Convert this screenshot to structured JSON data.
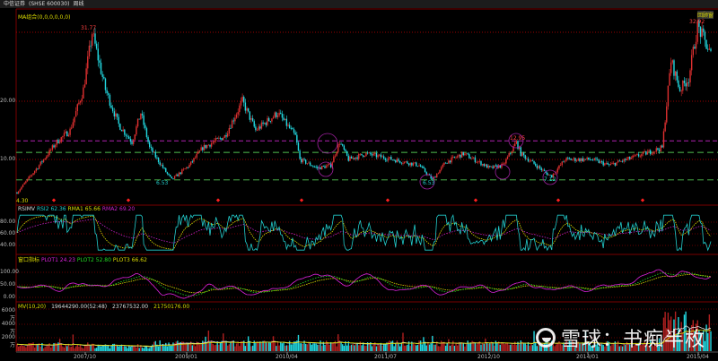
{
  "header": {
    "stock_name": "中信证券",
    "stock_code": "(SHSE 600030)",
    "period": "周线"
  },
  "chart_data": [
    {
      "type": "candlestick",
      "title": "MA组合(0,0,0,0,0,0)",
      "price_labels": {
        "high": "31.77",
        "high2": "32.92",
        "lows": [
          "6.53",
          "6.53",
          "7.12"
        ],
        "circle_label": "12.95",
        "start": "4.30"
      },
      "right_label": "回顾窗",
      "yticks": [
        "20.00",
        "10.00"
      ],
      "ylim": [
        4,
        34
      ],
      "reference_lines": {
        "magenta": 13.2,
        "green": [
          11.2,
          6.5
        ]
      },
      "xticks": [
        "2007/10",
        "2009/01",
        "2010/04",
        "2011/07",
        "2012/10",
        "2014/01",
        "2015/04"
      ],
      "path": [
        [
          0,
          4.3
        ],
        [
          5,
          9
        ],
        [
          9,
          13
        ],
        [
          12,
          15
        ],
        [
          15,
          22
        ],
        [
          17,
          31.77
        ],
        [
          20,
          22
        ],
        [
          23,
          16
        ],
        [
          26,
          13
        ],
        [
          28,
          18
        ],
        [
          30,
          12
        ],
        [
          34,
          7.5
        ],
        [
          35,
          6.53
        ],
        [
          39,
          9
        ],
        [
          42,
          12
        ],
        [
          47,
          14
        ],
        [
          51,
          20
        ],
        [
          54,
          15
        ],
        [
          59,
          18
        ],
        [
          63,
          14
        ],
        [
          64,
          10
        ],
        [
          68,
          8.5
        ],
        [
          71,
          9
        ],
        [
          73,
          13
        ],
        [
          75,
          10
        ],
        [
          79,
          11
        ],
        [
          85,
          10
        ],
        [
          91,
          9
        ],
        [
          94,
          6.53
        ],
        [
          97,
          9.5
        ],
        [
          101,
          11
        ],
        [
          107,
          8.5
        ],
        [
          110,
          9
        ],
        [
          113,
          12.95
        ],
        [
          114,
          11
        ],
        [
          120,
          7.5
        ],
        [
          121,
          7.12
        ],
        [
          124,
          10
        ],
        [
          130,
          10
        ],
        [
          134,
          9
        ],
        [
          138,
          10
        ],
        [
          146,
          12
        ],
        [
          148,
          27
        ],
        [
          150,
          22
        ],
        [
          152,
          24
        ],
        [
          154,
          32.92
        ],
        [
          157,
          28
        ]
      ]
    },
    {
      "type": "line",
      "title": "RSIMV",
      "legend": [
        {
          "name": "RSI2",
          "value": "62.36",
          "color": "#22cccc"
        },
        {
          "name": "RMA1",
          "value": "65.66",
          "color": "#dddd00"
        },
        {
          "name": "RMA2",
          "value": "69.20",
          "color": "#cc22cc"
        }
      ],
      "yticks": [
        "80.00",
        "60.00",
        "40.00"
      ],
      "ylim": [
        30,
        95
      ]
    },
    {
      "type": "line",
      "title": "窗口指标",
      "legend": [
        {
          "name": "PLOT1",
          "value": "24.23",
          "color": "#dd22dd"
        },
        {
          "name": "PLOT2",
          "value": "52.80",
          "color": "#22dd22"
        },
        {
          "name": "PLOT3",
          "value": "66.62",
          "color": "#dddd00"
        }
      ],
      "yticks": [
        "100.00",
        "50.00",
        "0.00"
      ],
      "ylim": [
        -10,
        125
      ]
    },
    {
      "type": "bar",
      "title": "MV(10,20)",
      "legend": [
        {
          "name": "",
          "value": "19644290.00(52:48)",
          "color": "#dddddd"
        },
        {
          "name": "",
          "value": "23767532.00",
          "color": "#dddddd"
        },
        {
          "name": "",
          "value": "21750176.00",
          "color": "#dddd00"
        }
      ],
      "yticks": [
        "6000万",
        "4000万",
        "2000万"
      ],
      "ylim": [
        0,
        7000
      ]
    }
  ],
  "watermark": "雪球：书痴半枚",
  "colors": {
    "up": "#e03030",
    "down": "#22d8e0",
    "grid": "#7a0000"
  }
}
